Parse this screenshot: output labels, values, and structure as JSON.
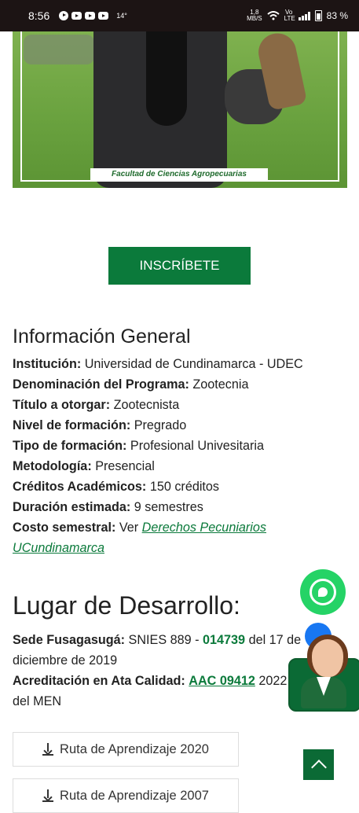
{
  "status_bar": {
    "time": "8:56",
    "temperature": "14°",
    "net_speed": "1,8",
    "net_unit": "MB/S",
    "wifi_label": "Vo LTE",
    "battery": "83 %"
  },
  "hero": {
    "caption": "Facultad de Ciencias Agropecuarias"
  },
  "cta_button": "INSCRÍBETE",
  "info_general": {
    "title": "Información General",
    "rows": [
      {
        "label": "Institución:",
        "value": "Universidad de Cundinamarca - UDEC"
      },
      {
        "label": "Denominación del Programa:",
        "value": "Zootecnia"
      },
      {
        "label": "Título a otorgar:",
        "value": "Zootecnista"
      },
      {
        "label": "Nivel de formación:",
        "value": "Pregrado"
      },
      {
        "label": "Tipo de formación:",
        "value": "Profesional Univesitaria"
      },
      {
        "label": "Metodología:",
        "value": "Presencial"
      },
      {
        "label": "Créditos Académicos:",
        "value": "150 créditos"
      },
      {
        "label": "Duración estimada:",
        "value": "9 semestres"
      }
    ],
    "cost_label": "Costo semestral:",
    "cost_prefix": "Ver",
    "cost_link_line1": "Derechos Pecuniarios",
    "cost_link_line2": "UCundinamarca"
  },
  "lugar": {
    "title": "Lugar de Desarrollo:",
    "sede_label": "Sede Fusagasugá:",
    "sede_pre": "SNIES 889 -",
    "sede_code": "014739",
    "sede_post": "del 17 de",
    "sede_line2": "diciembre de 2019",
    "acred_label": "Acreditación en Ata Calidad:",
    "acred_code": "AAC 09412",
    "acred_post": "2022",
    "acred_line2": "del MEN"
  },
  "downloads": [
    {
      "label": "Ruta de Aprendizaje 2020"
    },
    {
      "label": "Ruta de Aprendizaje 2007"
    }
  ]
}
